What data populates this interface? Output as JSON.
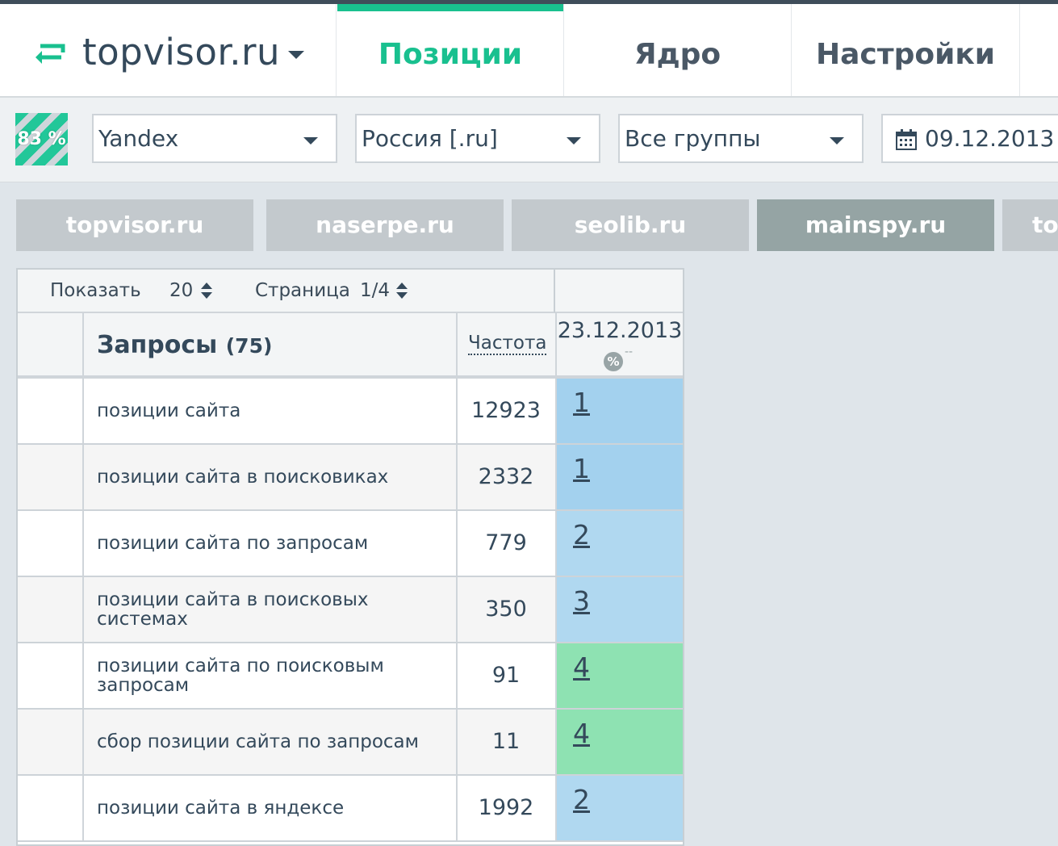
{
  "header": {
    "site_name": "topvisor.ru",
    "tabs": [
      {
        "label": "Позиции",
        "active": true
      },
      {
        "label": "Ядро",
        "active": false
      },
      {
        "label": "Настройки",
        "active": false
      }
    ]
  },
  "toolbar": {
    "percent_badge": "83 %",
    "search_engine": "Yandex",
    "region": "Россия [.ru]",
    "groups": "Все группы",
    "date_range": "09.12.2013 –"
  },
  "competitor_tabs": [
    "topvisor.ru",
    "naserpe.ru",
    "seolib.ru",
    "mainspy.ru",
    "topvisor.ru"
  ],
  "table": {
    "controls": {
      "show_label": "Показать",
      "show_value": "20",
      "page_label": "Страница",
      "page_value": "1/4"
    },
    "headers": {
      "queries": "Запросы",
      "queries_count": "(75)",
      "frequency": "Частота",
      "date": "23.12.2013",
      "percent_icon": "%",
      "percent_value": "--"
    },
    "rows": [
      {
        "query": "позиции сайта",
        "frequency": "12923",
        "position": "1"
      },
      {
        "query": "позиции сайта в поисковиках",
        "frequency": "2332",
        "position": "1"
      },
      {
        "query": "позиции сайта по запросам",
        "frequency": "779",
        "position": "2"
      },
      {
        "query": "позиции сайта в поисковых системах",
        "frequency": "350",
        "position": "3"
      },
      {
        "query": "позиции сайта по поисковым запросам",
        "frequency": "91",
        "position": "4"
      },
      {
        "query": "сбор позиции сайта по запросам",
        "frequency": "11",
        "position": "4"
      },
      {
        "query": "позиции сайта в яндексе",
        "frequency": "1992",
        "position": "2"
      }
    ]
  },
  "colors": {
    "accent": "#19c08f",
    "position_top": "#a3d1ee",
    "position_mid": "#b0d8f0",
    "position_green": "#8ee2b2"
  }
}
